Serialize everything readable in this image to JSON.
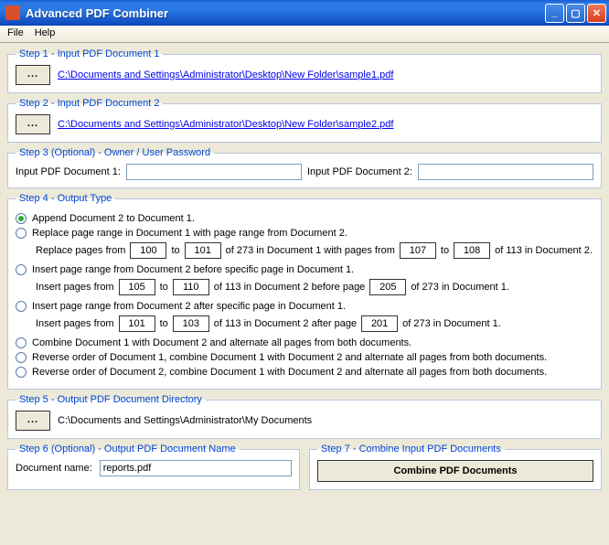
{
  "window": {
    "title": "Advanced PDF Combiner"
  },
  "menu": {
    "file": "File",
    "help": "Help"
  },
  "step1": {
    "legend": "Step 1 - Input PDF Document 1",
    "browse": "...",
    "path": "C:\\Documents and Settings\\Administrator\\Desktop\\New Folder\\sample1.pdf"
  },
  "step2": {
    "legend": "Step 2 - Input PDF Document 2",
    "browse": "...",
    "path": "C:\\Documents and Settings\\Administrator\\Desktop\\New Folder\\sample2.pdf"
  },
  "step3": {
    "legend": "Step 3 (Optional) - Owner / User Password",
    "label1": "Input PDF Document 1:",
    "value1": "",
    "label2": "Input PDF Document 2:",
    "value2": ""
  },
  "step4": {
    "legend": "Step 4 - Output Type",
    "opt1": "Append Document 2 to Document 1.",
    "opt2": "Replace page range in Document 1 with page range from Document 2.",
    "opt2_sub_a": "Replace pages from",
    "opt2_from": "100",
    "opt2_sub_b": "to",
    "opt2_to": "101",
    "opt2_sub_c": "of 273   in Document 1 with pages from",
    "opt2_from2": "107",
    "opt2_sub_d": "to",
    "opt2_to2": "108",
    "opt2_sub_e": "of 113   in Document 2.",
    "opt3": "Insert page range from Document 2 before specific page in Document 1.",
    "opt3_sub_a": "Insert pages from",
    "opt3_from": "105",
    "opt3_sub_b": "to",
    "opt3_to": "110",
    "opt3_sub_c": "of 113   in Document 2 before page",
    "opt3_page": "205",
    "opt3_sub_d": "of 273   in Document 1.",
    "opt4": "Insert page range from Document 2 after specific page in Document 1.",
    "opt4_sub_a": "Insert pages from",
    "opt4_from": "101",
    "opt4_sub_b": "to",
    "opt4_to": "103",
    "opt4_sub_c": "of 113   in Document 2 after page",
    "opt4_page": "201",
    "opt4_sub_d": "of 273   in Document 1.",
    "opt5": "Combine Document 1 with Document 2 and alternate all pages from both documents.",
    "opt6": "Reverse order of Document 1, combine Document 1 with Document 2 and alternate all pages from both documents.",
    "opt7": "Reverse order of Document 2, combine Document 1 with Document 2 and alternate all pages from both documents."
  },
  "step5": {
    "legend": "Step 5 - Output PDF Document Directory",
    "browse": "...",
    "path": "C:\\Documents and Settings\\Administrator\\My Documents"
  },
  "step6": {
    "legend": "Step 6 (Optional) - Output PDF Document Name",
    "label": "Document name:",
    "value": "reports.pdf"
  },
  "step7": {
    "legend": "Step 7 - Combine Input PDF Documents",
    "button": "Combine PDF Documents"
  }
}
